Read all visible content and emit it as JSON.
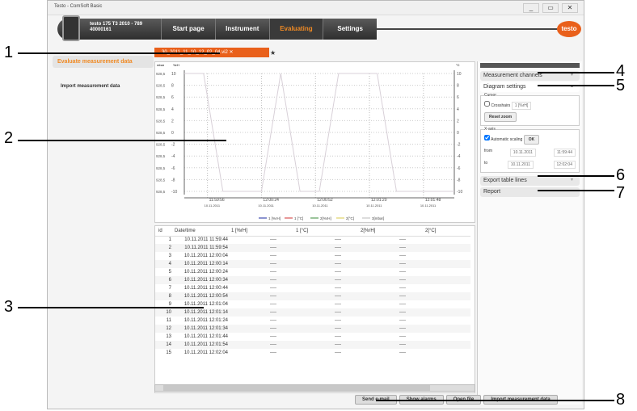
{
  "window": {
    "title": "Testo - ComSoft Basic",
    "controls": [
      "_",
      "▭",
      "✕"
    ]
  },
  "nav": {
    "device_name": "testo 175 T3 2010 - 789",
    "device_serial": "40000161",
    "tabs": [
      "Start page",
      "Instrument",
      "Evaluating",
      "Settings"
    ],
    "active": "Evaluating",
    "logo": "testo"
  },
  "left": {
    "items": [
      "Evaluate measurement data",
      "Import measurement data"
    ]
  },
  "doc_tab": {
    "title": "...30_2011_11_10_12_02_04.vi2",
    "close": "✕",
    "new": "★"
  },
  "chart_data": {
    "type": "line",
    "left_axis1_label": "mbar",
    "left_axis2_label": "%rH",
    "right_axis_label": "°C",
    "left_axis1_ticks": [
      "928,5",
      "928,5",
      "928,5",
      "928,5",
      "928,5",
      "928,5",
      "928,5",
      "928,5",
      "928,5",
      "928,5",
      "928,5"
    ],
    "y_ticks": [
      10,
      8,
      6,
      4,
      2,
      0,
      -2,
      -4,
      -6,
      -8,
      -10
    ],
    "ylim": [
      -10,
      10
    ],
    "x_ticks": [
      {
        "time": "11:59:56",
        "date": "10.11.2011"
      },
      {
        "time": "12:00:24",
        "date": "10.11.2011"
      },
      {
        "time": "12:00:52",
        "date": "10.11.2011"
      },
      {
        "time": "12:01:20",
        "date": "10.11.2011"
      },
      {
        "time": "12:01:48",
        "date": "10.11.2011"
      }
    ],
    "xlim": [
      "11:59:44",
      "12:02:04"
    ],
    "grid": true,
    "legend_position": "bottom",
    "legend": [
      {
        "name": "1 [%rH]",
        "color": "#1a2aa0"
      },
      {
        "name": "1 [°C]",
        "color": "#d03030"
      },
      {
        "name": "2[%rH]",
        "color": "#3a8a3a"
      },
      {
        "name": "2[°C]",
        "color": "#d8c84a"
      },
      {
        "name": "3[mbar]",
        "color": "#bbbbbb"
      }
    ],
    "series": [
      {
        "x": [
          "11:59:44",
          "11:59:54",
          "12:00:04",
          "12:00:24",
          "12:00:34",
          "12:00:44",
          "12:00:54",
          "12:01:04",
          "12:01:24",
          "12:01:34",
          "12:02:04"
        ],
        "y": [
          10,
          10,
          -10,
          -10,
          10,
          -10,
          -10,
          10,
          10,
          -10,
          -10
        ],
        "color": "#d8d0d8"
      }
    ]
  },
  "table": {
    "columns": [
      "id",
      "Date/time",
      "1 [%rH]",
      "1 [°C]",
      "2[%rH]",
      "2[°C]"
    ],
    "rows": [
      [
        "1",
        "10.11.2011 11:59:44"
      ],
      [
        "2",
        "10.11.2011 11:59:54"
      ],
      [
        "3",
        "10.11.2011 12:00:04"
      ],
      [
        "4",
        "10.11.2011 12:00:14"
      ],
      [
        "5",
        "10.11.2011 12:00:24"
      ],
      [
        "6",
        "10.11.2011 12:00:34"
      ],
      [
        "7",
        "10.11.2011 12:00:44"
      ],
      [
        "8",
        "10.11.2011 12:00:54"
      ],
      [
        "9",
        "10.11.2011 12:01:04"
      ],
      [
        "10",
        "10.11.2011 12:01:14"
      ],
      [
        "11",
        "10.11.2011 12:01:24"
      ],
      [
        "12",
        "10.11.2011 12:01:34"
      ],
      [
        "13",
        "10.11.2011 12:01:44"
      ],
      [
        "14",
        "10.11.2011 12:01:54"
      ],
      [
        "15",
        "10.11.2011 12:02:04"
      ]
    ],
    "empty_value": "----"
  },
  "right": {
    "measurement_channels": "Measurement channels",
    "diagram_settings": "Diagram settings",
    "cursor_label": "Cursor",
    "crosshairs": "Crosshairs",
    "crosshairs_select": "1 [%rH]",
    "reset_zoom": "Reset zoom",
    "xaxis_label": "X-axis",
    "auto_scaling": "Automatic scaling",
    "ok": "OK",
    "from_label": "from",
    "from_date": "10.11.2011",
    "from_time": "11:59:44",
    "to_label": "to",
    "to_date": "10.11.2011",
    "to_time": "12:02:04",
    "export": "Export table lines",
    "report": "Report"
  },
  "bottom_buttons": [
    "Send e-mail",
    "Show alarms",
    "Open file",
    "Import measurement data"
  ],
  "callouts": [
    "1",
    "2",
    "3",
    "4",
    "5",
    "6",
    "7",
    "8"
  ]
}
